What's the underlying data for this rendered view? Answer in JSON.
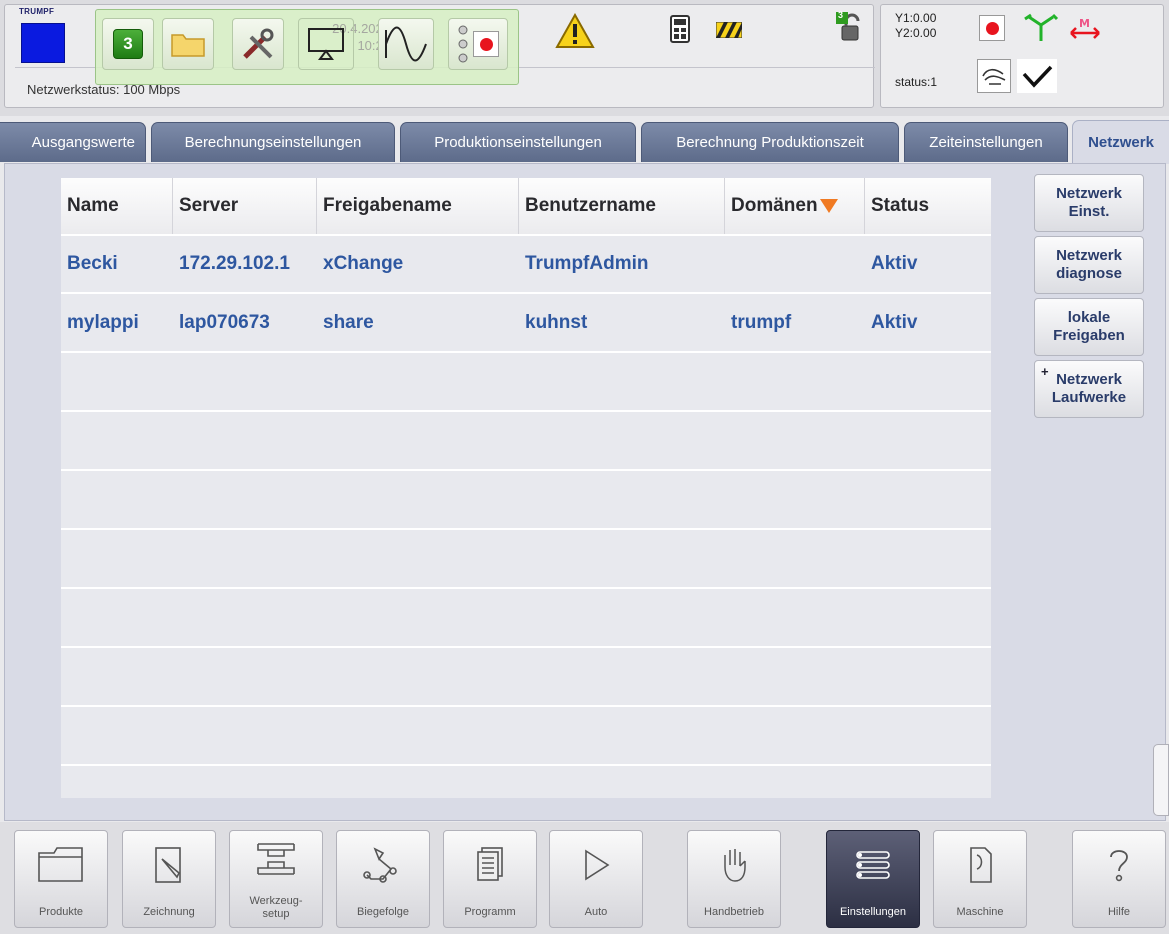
{
  "header": {
    "brand": "TRUMPF",
    "network_status": "Netzwerkstatus: 100 Mbps",
    "program_count": "3",
    "date": "20.4.2022",
    "time": "10:20",
    "lock_count": "3",
    "y1": "Y1:0.00",
    "y2": "Y2:0.00",
    "status": "status:1"
  },
  "tabs": [
    {
      "label": "Ausgangswerte",
      "active": false
    },
    {
      "label": "Berechnungseinstellungen",
      "active": false
    },
    {
      "label": "Produktionseinstellungen",
      "active": false
    },
    {
      "label": "Berechnung Produktionszeit",
      "active": false
    },
    {
      "label": "Zeiteinstellungen",
      "active": false
    },
    {
      "label": "Netzwerk",
      "active": true
    }
  ],
  "table": {
    "columns": [
      "Name",
      "Server",
      "Freigabename",
      "Benutzername",
      "Domänen",
      "Status"
    ],
    "rows": [
      [
        "Becki",
        "172.29.102.1",
        "xChange",
        "TrumpfAdmin",
        "",
        "Aktiv"
      ],
      [
        "mylappi",
        "lap070673",
        "share",
        "kuhnst",
        "trumpf",
        "Aktiv"
      ]
    ]
  },
  "side_buttons": [
    {
      "line1": "Netzwerk",
      "line2": "Einst."
    },
    {
      "line1": "Netzwerk",
      "line2": "diagnose"
    },
    {
      "line1": "lokale",
      "line2": "Freigaben"
    },
    {
      "line1": "Netzwerk",
      "line2": "Laufwerke",
      "plus": "+"
    }
  ],
  "bottom_nav": [
    {
      "label": "Produkte",
      "icon": "folder-icon"
    },
    {
      "label": "Zeichnung",
      "icon": "drawing-icon"
    },
    {
      "label": "Werkzeug-\nsetup",
      "icon": "tool-setup-icon"
    },
    {
      "label": "Biegefolge",
      "icon": "bend-sequence-icon"
    },
    {
      "label": "Programm",
      "icon": "program-icon"
    },
    {
      "label": "Auto",
      "icon": "play-icon"
    },
    {
      "label": "Handbetrieb",
      "icon": "hand-icon"
    },
    {
      "label": "Einstellungen",
      "icon": "settings-list-icon",
      "active": true
    },
    {
      "label": "Maschine",
      "icon": "machine-icon"
    },
    {
      "label": "Hilfe",
      "icon": "help-icon"
    }
  ],
  "colors": {
    "tab_bg": "#6b799a",
    "accent_blue": "#2e57a0",
    "sort_arrow": "#f07a22",
    "alert_yellow": "#f7d21a",
    "record_red": "#e8141e"
  }
}
